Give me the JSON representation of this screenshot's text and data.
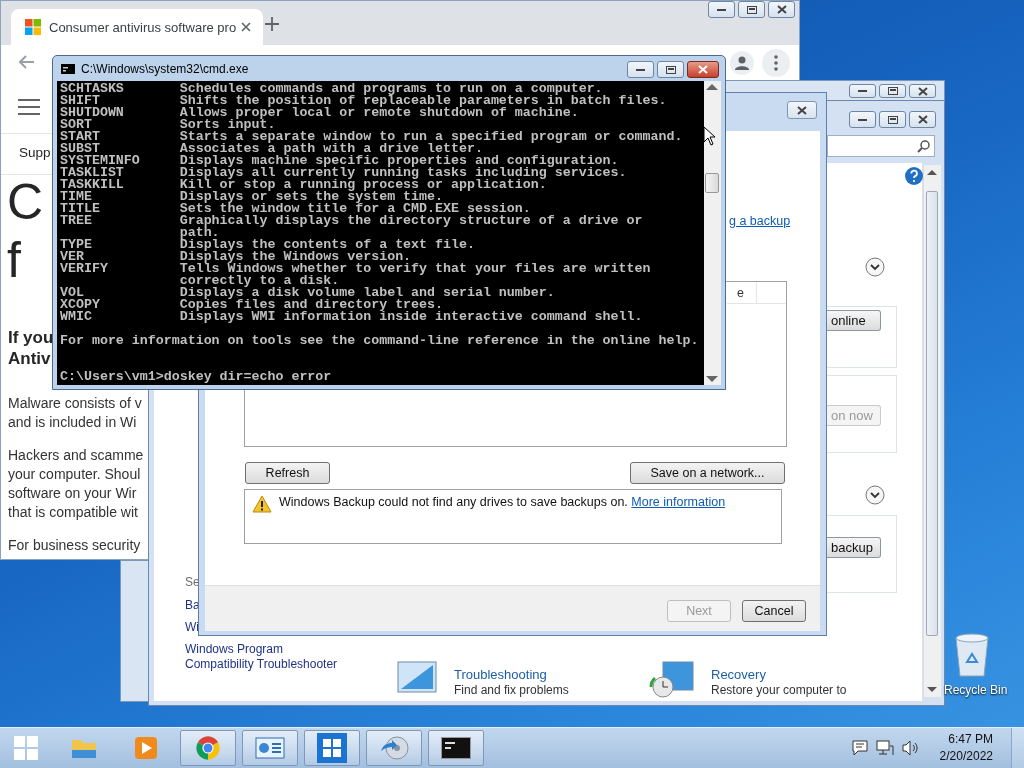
{
  "browser": {
    "tab_title": "Consumer antivirus software pro",
    "nav_item": "Supp",
    "heading_lines": [
      "C",
      "f"
    ],
    "subheading_lines": [
      "If you",
      "Antiv"
    ],
    "paragraphs": [
      [
        "Malware consists of v",
        "and is included in Wi"
      ],
      [
        "Hackers and scamme",
        "your computer. Shoul",
        "software on your Wir",
        "that is compatible wit"
      ],
      [
        "For business security"
      ]
    ]
  },
  "control_panel": {
    "see_also_heading": "Se",
    "links": [
      "Ba",
      "Wi",
      "Windows Program Compatibility Troubleshooter"
    ],
    "buttons": [
      {
        "label": "online",
        "disabled": false
      },
      {
        "label": "on now",
        "disabled": true
      },
      {
        "label": "backup",
        "disabled": false
      }
    ],
    "tiles": [
      {
        "kind": "troubleshooting",
        "title": "Troubleshooting",
        "description": "Find and fix problems"
      },
      {
        "kind": "recovery",
        "title": "Recovery",
        "description": "Restore your computer to"
      }
    ]
  },
  "backup_dialog": {
    "link": "g a backup",
    "column_header": "e",
    "refresh": "Refresh",
    "save_network": "Save on a network...",
    "message": "Windows Backup could not find any drives to save backups on.",
    "message_link": "More information",
    "buttons": [
      {
        "label": "Next",
        "disabled": true
      },
      {
        "label": "Cancel",
        "disabled": false
      }
    ]
  },
  "cmd": {
    "title": "C:\\Windows\\system32\\cmd.exe",
    "rows": [
      {
        "command": "SCHTASKS",
        "description": [
          "Schedules commands and programs to run on a computer."
        ]
      },
      {
        "command": "SHIFT",
        "description": [
          "Shifts the position of replaceable parameters in batch files."
        ]
      },
      {
        "command": "SHUTDOWN",
        "description": [
          "Allows proper local or remote shutdown of machine."
        ]
      },
      {
        "command": "SORT",
        "description": [
          "Sorts input."
        ]
      },
      {
        "command": "START",
        "description": [
          "Starts a separate window to run a specified program or command."
        ]
      },
      {
        "command": "SUBST",
        "description": [
          "Associates a path with a drive letter."
        ]
      },
      {
        "command": "SYSTEMINFO",
        "description": [
          "Displays machine specific properties and configuration."
        ]
      },
      {
        "command": "TASKLIST",
        "description": [
          "Displays all currently running tasks including services."
        ]
      },
      {
        "command": "TASKKILL",
        "description": [
          "Kill or stop a running process or application."
        ]
      },
      {
        "command": "TIME",
        "description": [
          "Displays or sets the system time."
        ]
      },
      {
        "command": "TITLE",
        "description": [
          "Sets the window title for a CMD.EXE session."
        ]
      },
      {
        "command": "TREE",
        "description": [
          "Graphically displays the directory structure of a drive or",
          "path."
        ]
      },
      {
        "command": "TYPE",
        "description": [
          "Displays the contents of a text file."
        ]
      },
      {
        "command": "VER",
        "description": [
          "Displays the Windows version."
        ]
      },
      {
        "command": "VERIFY",
        "description": [
          "Tells Windows whether to verify that your files are written",
          "correctly to a disk."
        ]
      },
      {
        "command": "VOL",
        "description": [
          "Displays a disk volume label and serial number."
        ]
      },
      {
        "command": "XCOPY",
        "description": [
          "Copies files and directory trees."
        ]
      },
      {
        "command": "WMIC",
        "description": [
          "Displays WMI information inside interactive command shell."
        ]
      }
    ],
    "footer": "For more information on tools see the command-line reference in the online help.",
    "prompt": "C:\\Users\\vm1>doskey dir=echo error"
  },
  "desktop_icons": [
    {
      "label": "Recycle Bin"
    }
  ],
  "taskbar": {
    "apps": [
      {
        "kind": "explorer",
        "running": false
      },
      {
        "kind": "media",
        "running": false
      },
      {
        "kind": "chrome",
        "running": true
      },
      {
        "kind": "control-panel",
        "running": true
      },
      {
        "kind": "windows",
        "running": true
      },
      {
        "kind": "backup",
        "running": true
      },
      {
        "kind": "console",
        "running": true
      }
    ],
    "time": "6:47 PM",
    "date": "2/20/2022"
  }
}
